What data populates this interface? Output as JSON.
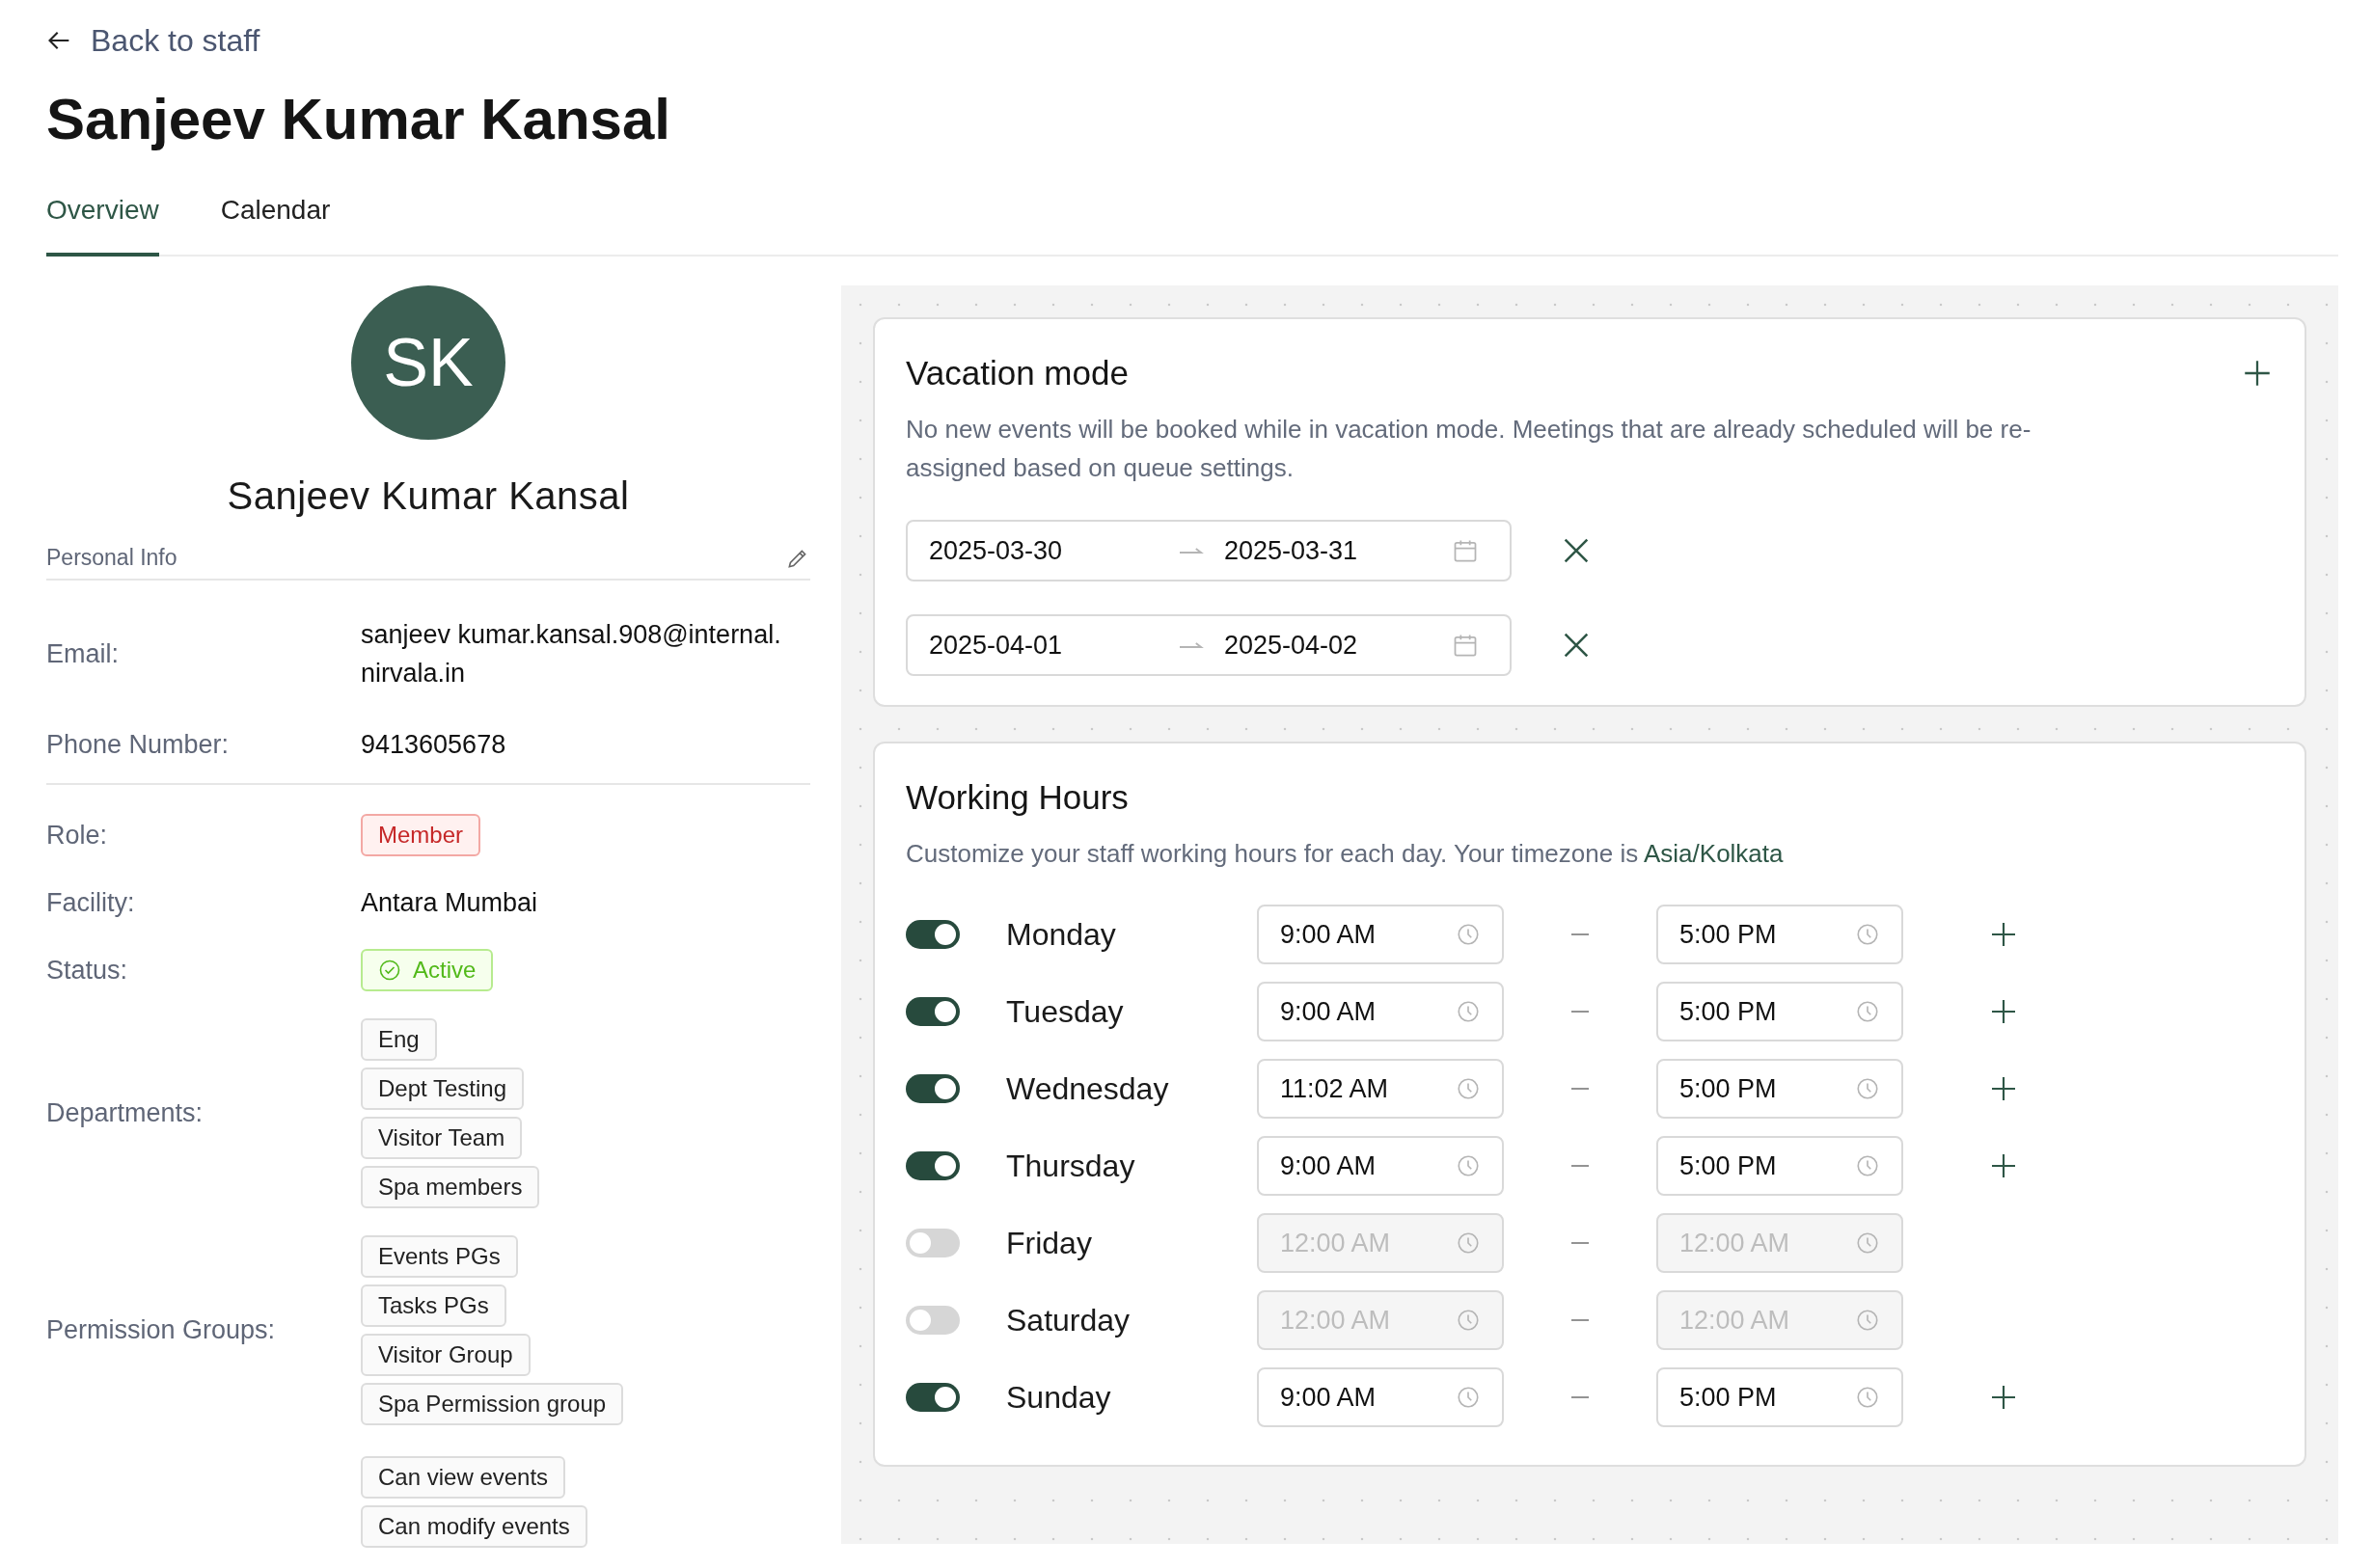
{
  "back_link": {
    "label": "Back to staff"
  },
  "page_title": "Sanjeev Kumar Kansal",
  "tabs": [
    {
      "label": "Overview",
      "selected": true
    },
    {
      "label": "Calendar",
      "selected": false
    }
  ],
  "profile": {
    "avatar_initials": "SK",
    "name": "Sanjeev Kumar Kansal",
    "section_label": "Personal Info"
  },
  "contact": [
    {
      "label": "Email:",
      "value": "sanjeev kumar.kansal.908@internal.nirvala.in"
    },
    {
      "label": "Phone Number:",
      "value": "9413605678"
    }
  ],
  "details": [
    {
      "kind": "role",
      "label": "Role:",
      "value": "Member"
    },
    {
      "kind": "text",
      "label": "Facility:",
      "value": "Antara Mumbai"
    },
    {
      "kind": "status",
      "label": "Status:",
      "value": "Active"
    },
    {
      "kind": "tags",
      "label": "Departments:",
      "tags": [
        "Eng",
        "Dept Testing",
        "Visitor Team",
        "Spa members"
      ]
    },
    {
      "kind": "tags",
      "label": "Permission Groups:",
      "tags": [
        "Events PGs",
        "Tasks PGs",
        "Visitor Group",
        "Spa Permission group"
      ]
    },
    {
      "kind": "tags",
      "tags": [
        "Can view events",
        "Can modify events"
      ]
    }
  ],
  "vacation_mode": {
    "title": "Vacation mode",
    "description": "No new events will be booked while in vacation mode. Meetings that are already scheduled will be re-assigned based on queue settings.",
    "ranges": [
      {
        "start": "2025-03-30",
        "end": "2025-03-31"
      },
      {
        "start": "2025-04-01",
        "end": "2025-04-02"
      }
    ]
  },
  "working_hours": {
    "title": "Working Hours",
    "description": "Customize your staff working hours for each day. Your timezone is",
    "timezone": "Asia/Kolkata",
    "days": [
      {
        "name": "Monday",
        "on": true,
        "start": "9:00 AM",
        "end": "5:00 PM"
      },
      {
        "name": "Tuesday",
        "on": true,
        "start": "9:00 AM",
        "end": "5:00 PM"
      },
      {
        "name": "Wednesday",
        "on": true,
        "start": "11:02 AM",
        "end": "5:00 PM"
      },
      {
        "name": "Thursday",
        "on": true,
        "start": "9:00 AM",
        "end": "5:00 PM"
      },
      {
        "name": "Friday",
        "on": false,
        "start": "12:00 AM",
        "end": "12:00 AM"
      },
      {
        "name": "Saturday",
        "on": false,
        "start": "12:00 AM",
        "end": "12:00 AM"
      },
      {
        "name": "Sunday",
        "on": true,
        "start": "9:00 AM",
        "end": "5:00 PM"
      }
    ]
  }
}
